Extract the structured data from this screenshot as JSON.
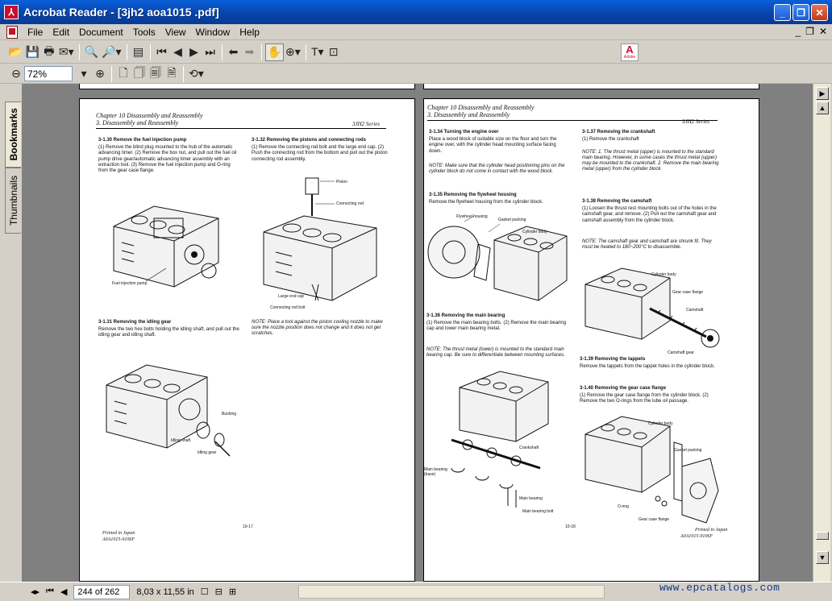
{
  "window": {
    "title": "Acrobat Reader - [3jh2 aoa1015 .pdf]",
    "app_icon": "acrobat-icon"
  },
  "menu": [
    "File",
    "Edit",
    "Document",
    "Tools",
    "View",
    "Window",
    "Help"
  ],
  "toolbar": {
    "zoom": "72%",
    "adobe_label": "Adobe"
  },
  "tabs": {
    "bookmarks": "Bookmarks",
    "thumbnails": "Thumbnails"
  },
  "status": {
    "page": "244 of 262",
    "size": "8,03 x 11,55 in",
    "watermark": "www.epcatalogs.com"
  },
  "left_page": {
    "header1": "Chapter 10 Disassembly and Reassembly",
    "header2": "3. Disassembly and Reassembly",
    "series": "3JH2 Series",
    "s130_title": "3-1.30 Remove the fuel injection pump",
    "s130_body": "(1) Remove the blind plug mounted to the hub of the automatic advancing timer. (2) Remove the box nut, and pull out the fuel oil pump drive gear/automatic advancing timer assembly with an extraction tool. (3) Remove the fuel injection pump and O-ring from the gear case flange.",
    "s132_title": "3-1.32 Removing the pistons and connecting rods",
    "s132_body": "(1) Remove the connecting rod bolt and the large end cap. (2) Push the connecting rod from the bottom and pull out the piston connecting rod assembly.",
    "lbl_fip": "Fuel injection pump",
    "lbl_piston": "Piston",
    "lbl_conrod": "Connecting rod",
    "lbl_largecap": "Large end cap",
    "lbl_crbolt": "Connecting rod bolt",
    "s131_title": "3-1.31 Removing the idling gear",
    "s131_body": "Remove the two hex bolts holding the idling shaft, and pull out the idling gear and idling shaft.",
    "note": "NOTE: Place a tool against the piston cooling nozzle to make sure the nozzle position does not change and it does not get scratches.",
    "lbl_bushing": "Bushing",
    "lbl_idshaft": "Idling shaft",
    "lbl_idgear": "Idling gear",
    "page_num": "10-17",
    "foot1": "Printed in Japan",
    "foot2": "A0A1015-9106F"
  },
  "right_page": {
    "header1": "Chapter 10 Disassembly and Reassembly",
    "header2": "3. Disassembly and Reassembly",
    "series": "3JH2 Series",
    "s134_title": "3-1.34 Turning the engine over",
    "s134_body": "Place a wood block of suitable size on the floor and turn the engine over, with the cylinder head mounting surface facing down.",
    "note134": "NOTE: Make sure that the cylinder head positioning pins on the cylinder block do not come in contact with the wood block.",
    "s135_title": "3-1.35 Removing the flywheel housing",
    "s135_body": "Remove the flywheel housing from the cylinder block.",
    "lbl_fwh": "Flywheel housing",
    "lbl_gasket": "Gasket packing",
    "lbl_cyl": "Cylinder body",
    "s136_title": "3-1.36 Removing the main bearing",
    "s136_body": "(1) Remove the main bearing bolts. (2) Remove the main bearing cap and lower main bearing metal.",
    "note136": "NOTE: The thrust metal (lower) is mounted to the standard main bearing cap. Be sure to differentiate between mounting surfaces.",
    "lbl_crank": "Crankshaft",
    "lbl_mb": "Main bearing (base)",
    "lbl_mb2": "Main bearing",
    "lbl_mbbolt": "Main bearing bolt",
    "s137_title": "3-1.37 Removing the crankshaft",
    "s137_body": "(1) Remove the crankshaft",
    "note137": "NOTE: 1. The thrust metal (upper) is mounted to the standard main bearing. However, in some cases the thrust metal (upper) may be mounted to the crankshaft. 2. Remove the main bearing metal (upper) from the cylinder block.",
    "s138_title": "3-1.38 Removing the camshaft",
    "s138_body": "(1) Loosen the thrust rest mounting bolts out of the holes in the camshaft gear, and remove. (2) Pull out the camshaft gear and camshaft assembly from the cylinder block.",
    "note138": "NOTE: The camshaft gear and camshaft are shrunk fit. They must be heated to 180~200°C to disassemble.",
    "lbl_cyl2": "Cylinder body",
    "lbl_gcf": "Gear case flange",
    "lbl_cam": "Camshaft",
    "lbl_camgear": "Camshaft gear",
    "s139_title": "3-1.39 Removing the tappets",
    "s139_body": "Remove the tappets from the tappet holes in the cylinder block.",
    "s140_title": "3-1.40 Removing the gear case flange",
    "s140_body": "(1) Remove the gear case flange from the cylinder block. (2) Remove the two O-rings from the lube oil passage.",
    "lbl_cyl3": "Cylinder body",
    "lbl_gasket2": "Gasket packing",
    "lbl_oring": "O-ring",
    "lbl_gcf2": "Gear case flange",
    "page_num": "10-18",
    "foot1": "Printed in Japan",
    "foot2": "A0A1015-9106F"
  }
}
